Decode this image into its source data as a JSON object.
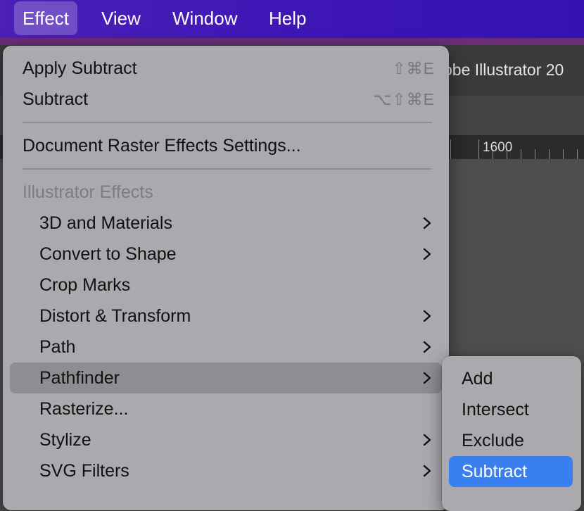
{
  "menubar": {
    "items": [
      {
        "label": "Effect",
        "active": true
      },
      {
        "label": "View"
      },
      {
        "label": "Window"
      },
      {
        "label": "Help"
      }
    ]
  },
  "app_window": {
    "title": "obe Illustrator 20",
    "ruler_label": "1600"
  },
  "effect_menu": {
    "apply": {
      "label": "Apply Subtract",
      "shortcut": "⇧⌘E"
    },
    "last": {
      "label": "Subtract",
      "shortcut": "⌥⇧⌘E"
    },
    "raster_settings": "Document Raster Effects Settings...",
    "section_header": "Illustrator Effects",
    "items": [
      {
        "label": "3D and Materials",
        "submenu": true
      },
      {
        "label": "Convert to Shape",
        "submenu": true
      },
      {
        "label": "Crop Marks",
        "submenu": false
      },
      {
        "label": "Distort & Transform",
        "submenu": true
      },
      {
        "label": "Path",
        "submenu": true
      },
      {
        "label": "Pathfinder",
        "submenu": true,
        "highlighted": true
      },
      {
        "label": "Rasterize...",
        "submenu": false
      },
      {
        "label": "Stylize",
        "submenu": true
      },
      {
        "label": "SVG Filters",
        "submenu": true
      }
    ]
  },
  "pathfinder_submenu": {
    "items": [
      {
        "label": "Add"
      },
      {
        "label": "Intersect"
      },
      {
        "label": "Exclude"
      },
      {
        "label": "Subtract",
        "selected": true
      }
    ]
  },
  "colors": {
    "menubar": "#3f16b6",
    "menu_bg": "#aaa9ad",
    "highlight": "#8e8d91",
    "selection": "#3a7ff0"
  }
}
